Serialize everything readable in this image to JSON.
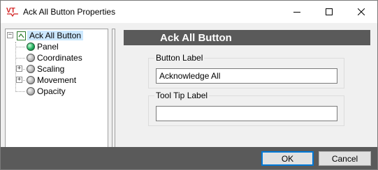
{
  "window": {
    "title": "Ack All Button Properties",
    "app_icon": "vt-logo-icon"
  },
  "titlebar_buttons": [
    "minimize-icon",
    "maximize-icon",
    "close-icon"
  ],
  "tree": {
    "root": {
      "label": "Ack All Button",
      "icon": "button-node-icon",
      "expanded": true
    },
    "items": [
      {
        "label": "Panel",
        "icon": "green-ball-icon",
        "expandable": false
      },
      {
        "label": "Coordinates",
        "icon": "grey-ball-icon",
        "expandable": false
      },
      {
        "label": "Scaling",
        "icon": "grey-ball-icon",
        "expandable": true
      },
      {
        "label": "Movement",
        "icon": "grey-ball-icon",
        "expandable": true
      },
      {
        "label": "Opacity",
        "icon": "grey-ball-icon",
        "expandable": false
      }
    ]
  },
  "header": {
    "title": "Ack All Button"
  },
  "fields": {
    "button_label": {
      "label": "Button Label",
      "value": "Acknowledge All"
    },
    "tooltip_label": {
      "label": "Tool Tip Label",
      "value": ""
    }
  },
  "footer": {
    "ok_label": "OK",
    "cancel_label": "Cancel"
  },
  "colors": {
    "header_bg": "#5a5a5a",
    "footer_bg": "#5a5a5a",
    "selection": "#cce8ff",
    "ok_border": "#0078d7"
  }
}
